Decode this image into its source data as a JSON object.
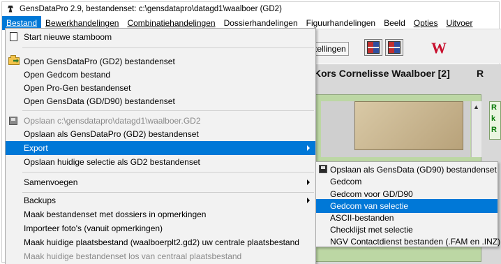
{
  "window": {
    "title": "GensDataPro 2.9, bestandenset: c:\\gensdatapro\\datagd1\\waalboer (GD2)"
  },
  "menubar": {
    "items": [
      "Bestand",
      "Bewerkhandelingen",
      "Combinatiehandelingen",
      "Dossierhandelingen",
      "Figuurhandelingen",
      "Beeld",
      "Opties",
      "Uitvoer"
    ],
    "active": "Bestand"
  },
  "background": {
    "toolbar_text": "tellingen",
    "w_button": "W",
    "person_title": "Kors Cornelisse Waalboer [2]",
    "person_title_right": "R",
    "side_letters": [
      "R",
      "k",
      "R"
    ]
  },
  "bestand_menu": {
    "items": [
      {
        "label": "Start nieuwe stamboom",
        "icon": "new-document-icon"
      },
      {
        "label": "Open GensDataPro (GD2) bestandenset",
        "icon": "open-folder-icon"
      },
      {
        "label": "Open Gedcom bestand"
      },
      {
        "label": "Open Pro-Gen bestandenset"
      },
      {
        "label": "Open GensData (GD/D90) bestandenset"
      },
      {
        "label": "Opslaan c:\\gensdatapro\\datagd1\\waalboer.GD2",
        "icon": "save-disk-icon",
        "disabled": true
      },
      {
        "label": "Opslaan als GensDataPro (GD2) bestandenset"
      },
      {
        "label": "Export",
        "submenu": true,
        "highlighted": true
      },
      {
        "label": "Opslaan huidige selectie als GD2 bestandenset"
      },
      {
        "label": "Samenvoegen",
        "submenu": true
      },
      {
        "label": "Backups",
        "submenu": true
      },
      {
        "label": "Maak bestandenset met dossiers in opmerkingen"
      },
      {
        "label": "Importeer foto's (vanuit opmerkingen)"
      },
      {
        "label": "Maak huidige plaatsbestand (waalboerplt2.gd2) uw centrale plaatsbestand"
      },
      {
        "label": "Maak huidige bestandenset los van centraal plaatsbestand",
        "disabled": true
      }
    ]
  },
  "export_submenu": {
    "items": [
      {
        "label": "Opslaan als GensData (GD90) bestandenset",
        "icon": "save-disk-icon"
      },
      {
        "label": "Gedcom"
      },
      {
        "label": "Gedcom voor GD/D90"
      },
      {
        "label": "Gedcom van selectie",
        "highlighted": true
      },
      {
        "label": "ASCII-bestanden"
      },
      {
        "label": "Checklijst met selectie"
      },
      {
        "label": "NGV Contactdienst bestanden (.FAM en .INZ)"
      }
    ]
  },
  "colors": {
    "highlight": "#0078d7",
    "menu_bg": "#f2f2f2",
    "disabled_text": "#8a8a8a"
  }
}
